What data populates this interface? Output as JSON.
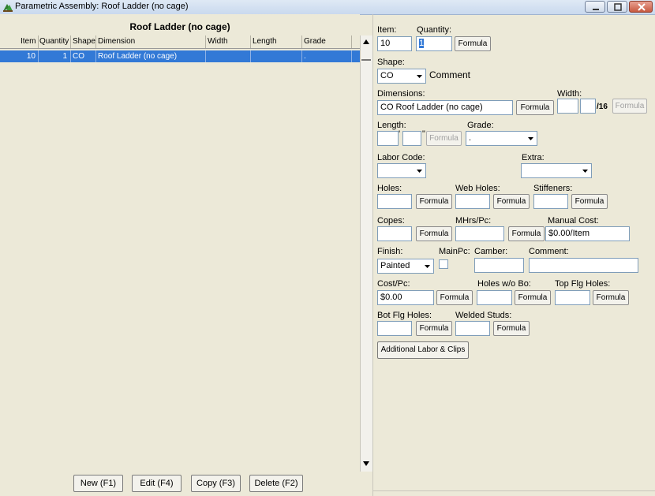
{
  "window": {
    "title": "Parametric Assembly: Roof Ladder (no cage)"
  },
  "grid": {
    "title": "Roof Ladder (no cage)",
    "columns": [
      "Item",
      "Quantity",
      "Shape",
      "Dimension",
      "Width",
      "Length",
      "Grade"
    ],
    "rows": [
      {
        "item": "10",
        "quantity": "1",
        "shape": "CO",
        "dimension": "Roof Ladder (no cage)",
        "width": "",
        "length": "",
        "grade": "."
      }
    ]
  },
  "bottom_buttons": {
    "new": "New (F1)",
    "edit": "Edit (F4)",
    "copy": "Copy (F3)",
    "delete": "Delete (F2)"
  },
  "form": {
    "item": {
      "label": "Item:",
      "value": "10"
    },
    "quantity": {
      "label": "Quantity:",
      "value": "1",
      "formula": "Formula"
    },
    "shape": {
      "label": "Shape:",
      "value": "CO",
      "comment": "Comment"
    },
    "dimensions": {
      "label": "Dimensions:",
      "value": "CO Roof Ladder (no cage)",
      "formula": "Formula"
    },
    "width": {
      "label": "Width:",
      "sixteenths": "/16",
      "formula": "Formula"
    },
    "length": {
      "label": "Length:",
      "feet_mark": "'",
      "inch_mark": "\"",
      "formula": "Formula"
    },
    "grade": {
      "label": "Grade:",
      "value": "."
    },
    "labor_code": {
      "label": "Labor Code:",
      "value": ""
    },
    "extra": {
      "label": "Extra:",
      "value": ""
    },
    "holes": {
      "label": "Holes:",
      "formula": "Formula"
    },
    "web_holes": {
      "label": "Web Holes:",
      "formula": "Formula"
    },
    "stiffeners": {
      "label": "Stiffeners:",
      "formula": "Formula"
    },
    "copes": {
      "label": "Copes:",
      "formula": "Formula"
    },
    "mhrs": {
      "label": "MHrs/Pc:",
      "formula": "Formula"
    },
    "manual_cost": {
      "label": "Manual Cost:",
      "value": "$0.00/Item"
    },
    "finish": {
      "label": "Finish:",
      "value": "Painted"
    },
    "mainpc": {
      "label": "MainPc:",
      "checked": false
    },
    "camber": {
      "label": "Camber:"
    },
    "comment": {
      "label": "Comment:"
    },
    "cost_pc": {
      "label": "Cost/Pc:",
      "value": "$0.00",
      "formula": "Formula"
    },
    "holes_wo_bo": {
      "label": "Holes w/o Bo:",
      "formula": "Formula"
    },
    "top_flg_holes": {
      "label": "Top Flg Holes:",
      "formula": "Formula"
    },
    "bot_flg_holes": {
      "label": "Bot Flg Holes:",
      "formula": "Formula"
    },
    "welded_studs": {
      "label": "Welded Studs:",
      "formula": "Formula"
    },
    "additional": "Additional Labor & Clips"
  },
  "colors": {
    "selection": "#3279d6",
    "background": "#ece9d8",
    "close_button": "#c75a40"
  }
}
